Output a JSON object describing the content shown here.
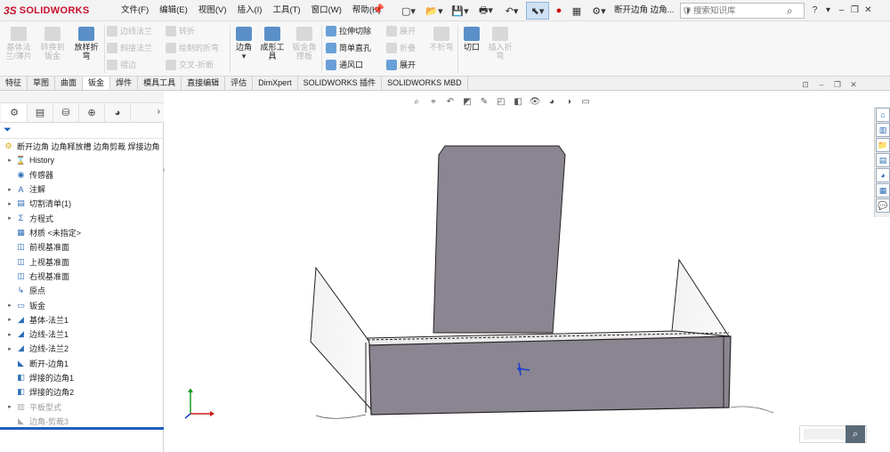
{
  "app": {
    "logo_ds": "3S",
    "logo_text": "SOLIDWORKS"
  },
  "menu": [
    "文件(F)",
    "编辑(E)",
    "视图(V)",
    "插入(I)",
    "工具(T)",
    "窗口(W)",
    "帮助(H)"
  ],
  "document_title": "断开边角 边角...",
  "search": {
    "placeholder": "搜索知识库"
  },
  "window_controls": {
    "help": "?",
    "min": "–",
    "restore": "❐",
    "close": "✕"
  },
  "ribbon": {
    "base_flange": "基体法兰/薄片",
    "convert_to_sheet": "转换到钣金",
    "lofted_bend": "放样折弯",
    "edge_flange": "边线法兰",
    "miter_flange": "斜接法兰",
    "hem": "褶边",
    "jog": "转折",
    "sketched_bend": "绘制的折弯",
    "cross_break": "交叉-折断",
    "corners": "边角",
    "forming_tool": "成形工具",
    "sheet_gusset": "钣金角撑板",
    "extruded_cut": "拉伸切除",
    "simple_hole": "简单直孔",
    "vent": "通风口",
    "unfold": "展开",
    "fold": "折叠",
    "no_bends": "不折弯",
    "flatten": "展开",
    "rip": "切口",
    "insert_bends": "插入折弯"
  },
  "tabs": [
    {
      "label": "特征",
      "active": false
    },
    {
      "label": "草图",
      "active": false
    },
    {
      "label": "曲面",
      "active": false
    },
    {
      "label": "钣金",
      "active": true
    },
    {
      "label": "焊件",
      "active": false
    },
    {
      "label": "模具工具",
      "active": false
    },
    {
      "label": "直接编辑",
      "active": false
    },
    {
      "label": "评估",
      "active": false
    },
    {
      "label": "DimXpert",
      "active": false
    },
    {
      "label": "SOLIDWORKS 插件",
      "active": false
    },
    {
      "label": "SOLIDWORKS MBD",
      "active": false
    }
  ],
  "tree": {
    "root": "断开边角 边角释放槽 边角剪裁 焊接边角",
    "items": [
      {
        "label": "History",
        "expand": true,
        "icon": "history-icon",
        "glyph": "⌛",
        "dim": false
      },
      {
        "label": "传感器",
        "expand": false,
        "icon": "sensor-icon",
        "glyph": "◉",
        "dim": false
      },
      {
        "label": "注解",
        "expand": true,
        "icon": "annotation-icon",
        "glyph": "A",
        "dim": false
      },
      {
        "label": "切割清单(1)",
        "expand": true,
        "icon": "cutlist-icon",
        "glyph": "▤",
        "dim": false
      },
      {
        "label": "方程式",
        "expand": true,
        "icon": "equation-icon",
        "glyph": "Σ",
        "dim": false
      },
      {
        "label": "材质 <未指定>",
        "expand": false,
        "icon": "material-icon",
        "glyph": "▦",
        "dim": false
      },
      {
        "label": "前视基准面",
        "expand": false,
        "icon": "plane-icon",
        "glyph": "◫",
        "dim": false
      },
      {
        "label": "上视基准面",
        "expand": false,
        "icon": "plane-icon",
        "glyph": "◫",
        "dim": false
      },
      {
        "label": "右视基准面",
        "expand": false,
        "icon": "plane-icon",
        "glyph": "◫",
        "dim": false
      },
      {
        "label": "原点",
        "expand": false,
        "icon": "origin-icon",
        "glyph": "↳",
        "dim": false
      },
      {
        "label": "钣金",
        "expand": true,
        "icon": "sheetmetal-icon",
        "glyph": "▭",
        "dim": false
      },
      {
        "label": "基体-法兰1",
        "expand": true,
        "icon": "flange-icon",
        "glyph": "◢",
        "dim": false
      },
      {
        "label": "边线-法兰1",
        "expand": true,
        "icon": "flange-icon",
        "glyph": "◢",
        "dim": false
      },
      {
        "label": "边线-法兰2",
        "expand": true,
        "icon": "flange-icon",
        "glyph": "◢",
        "dim": false
      },
      {
        "label": "断开-边角1",
        "expand": false,
        "icon": "corner-icon",
        "glyph": "◣",
        "dim": false
      },
      {
        "label": "焊接的边角1",
        "expand": false,
        "icon": "weld-corner-icon",
        "glyph": "◧",
        "dim": false
      },
      {
        "label": "焊接的边角2",
        "expand": false,
        "icon": "weld-corner-icon",
        "glyph": "◧",
        "dim": false
      },
      {
        "label": "平板型式",
        "expand": true,
        "icon": "flat-pattern-icon",
        "glyph": "▥",
        "dim": true
      },
      {
        "label": "边角-剪裁3",
        "expand": false,
        "icon": "corner-trim-icon",
        "glyph": "◣",
        "dim": true
      }
    ]
  }
}
